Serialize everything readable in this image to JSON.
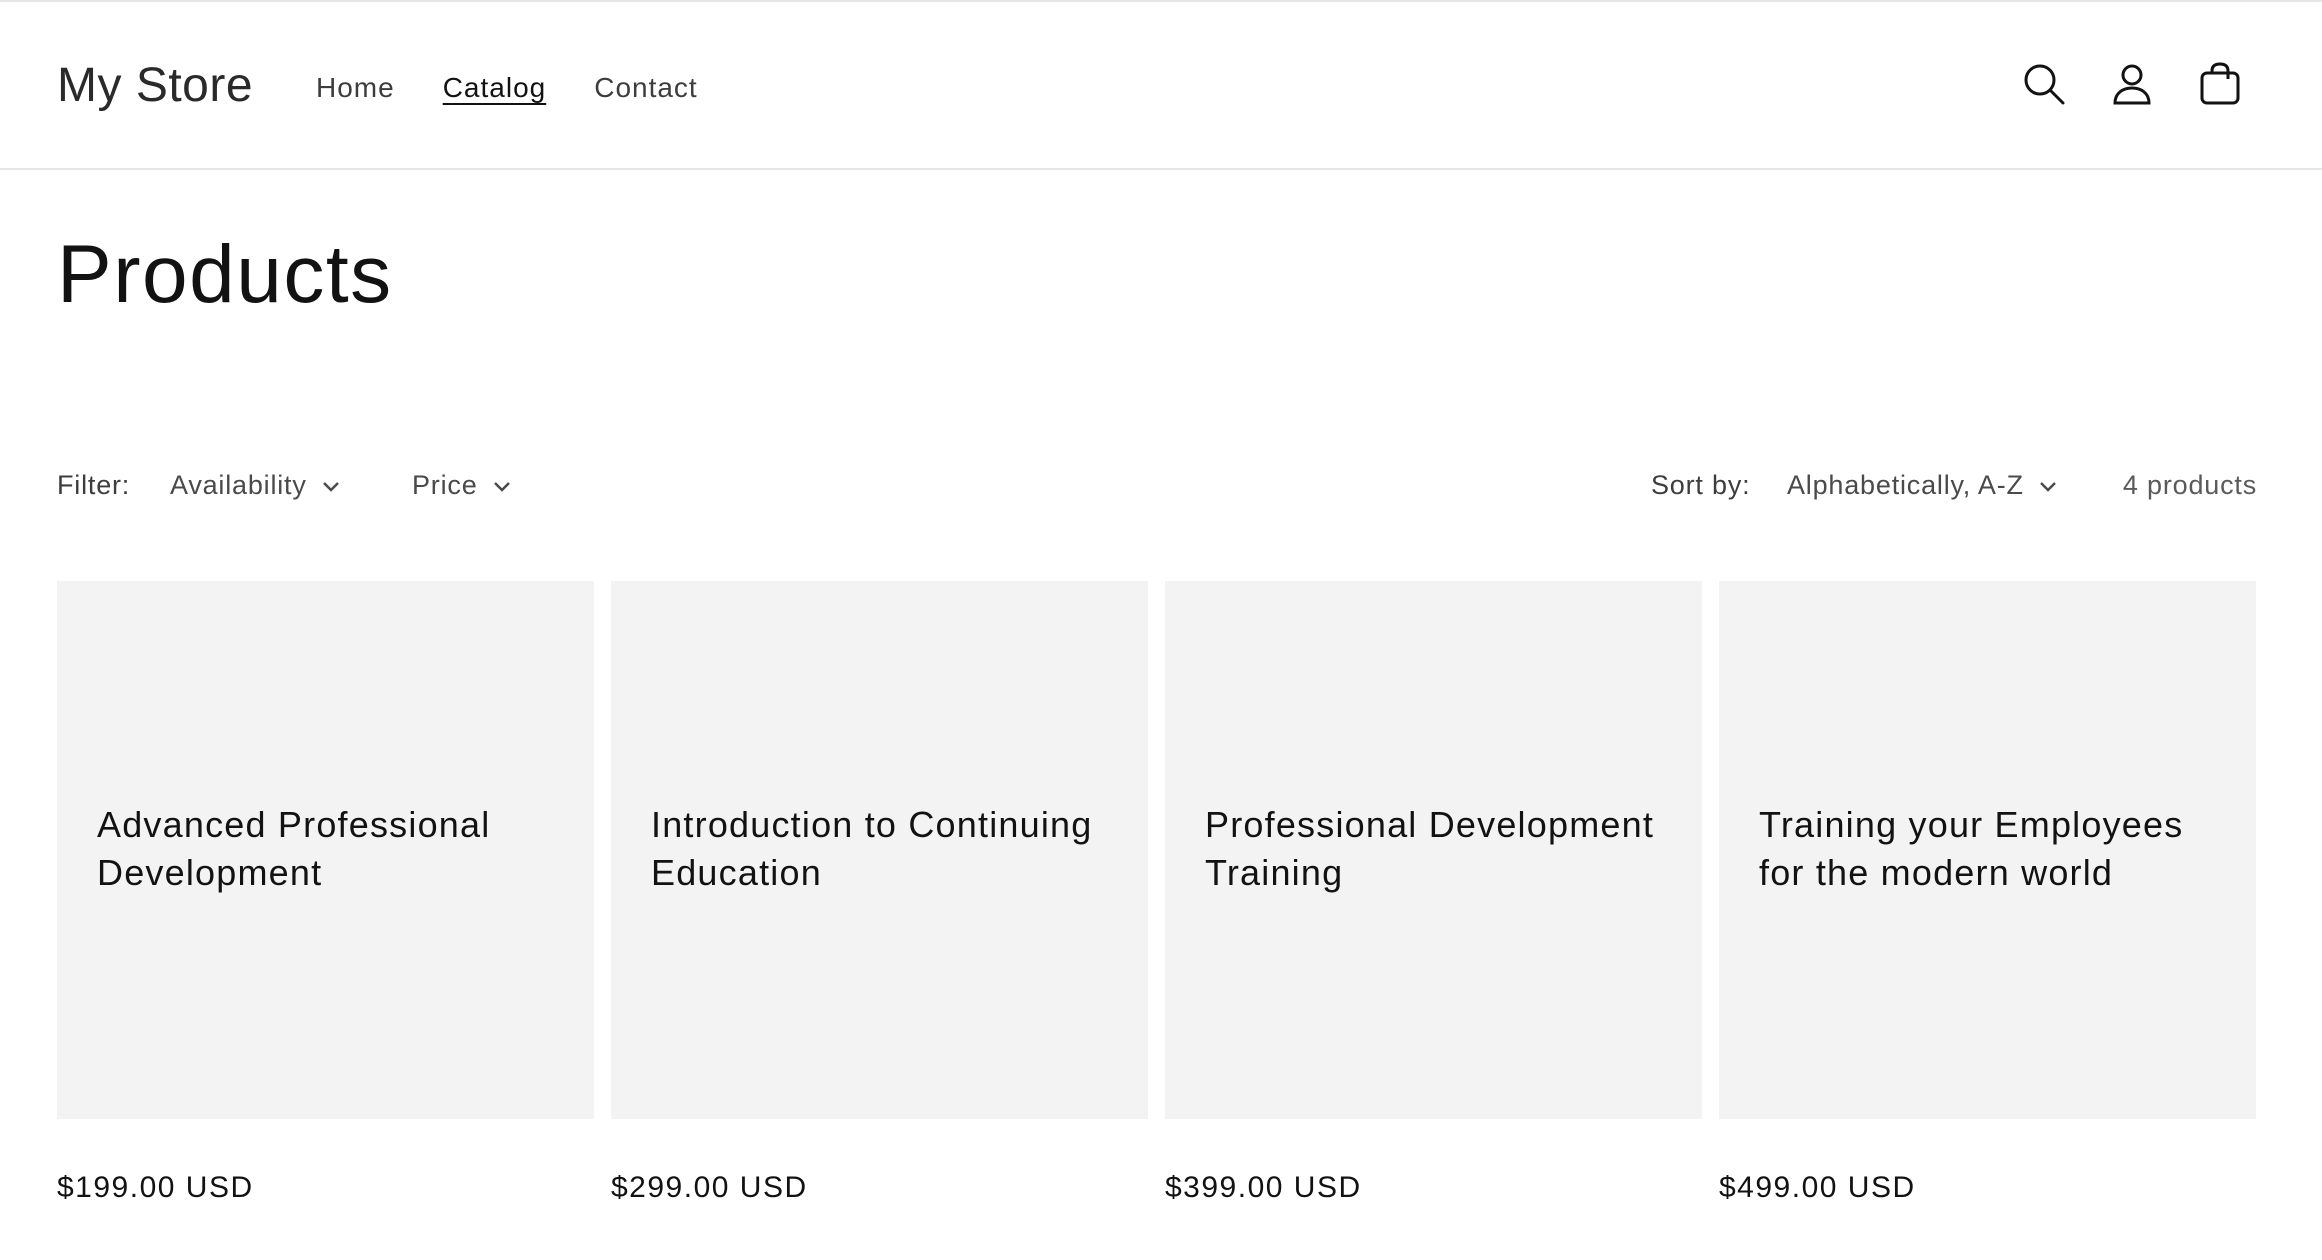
{
  "header": {
    "logo": "My Store",
    "nav": [
      {
        "label": "Home",
        "active": false
      },
      {
        "label": "Catalog",
        "active": true
      },
      {
        "label": "Contact",
        "active": false
      }
    ],
    "icons": [
      "search-icon",
      "account-icon",
      "cart-icon"
    ]
  },
  "main": {
    "title": "Products",
    "filter": {
      "label": "Filter:",
      "availability": "Availability",
      "price": "Price"
    },
    "sort": {
      "label": "Sort by:",
      "value": "Alphabetically, A-Z"
    },
    "count": "4 products",
    "products": [
      {
        "title": "Advanced Professional Development",
        "price": "$199.00 USD"
      },
      {
        "title": "Introduction to Continuing Education",
        "price": "$299.00 USD"
      },
      {
        "title": "Professional Development Training",
        "price": "$399.00 USD"
      },
      {
        "title": "Training your Employees for the modern world",
        "price": "$499.00 USD"
      }
    ]
  },
  "colors": {
    "text": "#121212",
    "card_bg": "#f3f3f3",
    "border": "#e6e6e6"
  }
}
